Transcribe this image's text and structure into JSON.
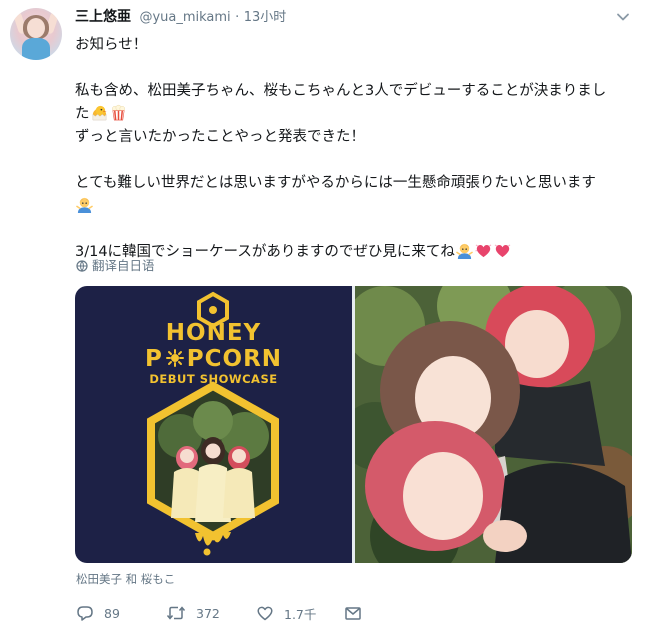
{
  "user": {
    "display_name": "三上悠亜",
    "handle": "@yua_mikami",
    "separator": "·",
    "time": "13小时"
  },
  "tweet": {
    "lines": [
      "お知らせ！",
      "",
      "私も含め、松田美子ちゃん、桜もこちゃんと3人でデビューすることが決まりまし",
      "た",
      "ずっと言いたかったことやっと発表できた！",
      "",
      "とても難しい世界だとは思いますがやるからには一生懸命頑張りたいと思います",
      "",
      "",
      "3/14に韓国でショーケースがありますのでぜひ見に来てね"
    ],
    "emojis": [
      "hatching-chick-emoji",
      "popcorn-emoji",
      "person-emoji",
      "person-emoji",
      "heart-emoji",
      "heart-emoji"
    ]
  },
  "translate_label": "翻译自日语",
  "media": {
    "poster": {
      "title_line1": "HONEY",
      "title_line2": "P O PCORN",
      "title_line2_a": "P",
      "title_line2_b": "PCORN",
      "subtitle": "DEBUT SHOWCASE"
    },
    "photo_alt": "selfie-photo"
  },
  "tagged": "松田美子 和 桜もこ",
  "actions": {
    "reply_count": "89",
    "retweet_count": "372",
    "like_count": "1.7千"
  },
  "colors": {
    "poster_bg": "#1d2146",
    "poster_gold": "#f2c230",
    "muted_text": "#657786"
  }
}
